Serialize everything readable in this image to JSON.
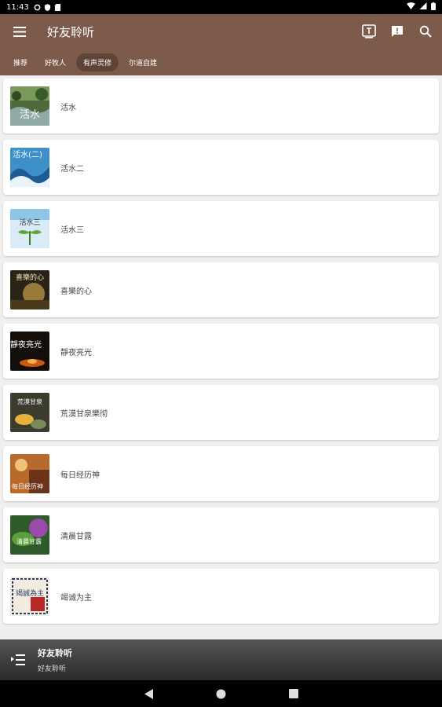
{
  "status": {
    "time": "11:43"
  },
  "appbar": {
    "title": "好友聆听",
    "icons": [
      "menu-icon",
      "tv-icon",
      "message-icon",
      "search-icon"
    ]
  },
  "tabs": [
    {
      "label": "推荐",
      "active": false
    },
    {
      "label": "好牧人",
      "active": false
    },
    {
      "label": "有声灵修",
      "active": true
    },
    {
      "label": "尔道自建",
      "active": false
    }
  ],
  "items": [
    {
      "label": "活水",
      "thumb_text": "活水"
    },
    {
      "label": "活水二",
      "thumb_text": "活水(二)"
    },
    {
      "label": "活水三",
      "thumb_text": "活水三"
    },
    {
      "label": "喜樂的心",
      "thumb_text": "喜樂的心"
    },
    {
      "label": "靜夜亮光",
      "thumb_text": "靜夜亮光"
    },
    {
      "label": "荒漠甘泉樂彻",
      "thumb_text": "荒漠甘泉"
    },
    {
      "label": "每日经历神",
      "thumb_text": "每日经历神"
    },
    {
      "label": "清晨甘露",
      "thumb_text": "清晨甘露"
    },
    {
      "label": "竭诚为主",
      "thumb_text": "竭誠為主"
    }
  ],
  "player": {
    "title": "好友聆听",
    "subtitle": "好友聆听"
  },
  "colors": {
    "appbar": "#7d5b4b",
    "active_tab": "#5e4337",
    "background": "#f0efee"
  }
}
